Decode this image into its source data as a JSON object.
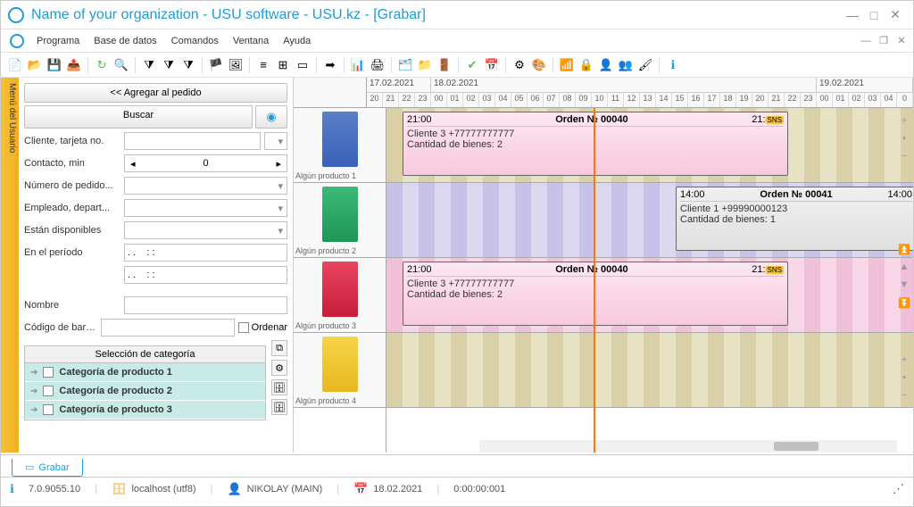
{
  "window": {
    "title": "Name of your organization - USU software - USU.kz - [Grabar]"
  },
  "menu": {
    "items": [
      "Programa",
      "Base de datos",
      "Comandos",
      "Ventana",
      "Ayuda"
    ]
  },
  "sidetab": "Menú del Usuario",
  "left": {
    "add_btn": "<< Agregar al pedido",
    "search_btn": "Buscar",
    "fields": {
      "cliente": "Cliente, tarjeta no.",
      "contacto": "Contacto, min",
      "contacto_val": "0",
      "pedido": "Número de pedido...",
      "empleado": "Empleado, depart...",
      "disponibles": "Están disponibles",
      "periodo": "En el período",
      "periodo_v1": ". .    : :",
      "periodo_v2": ". .    : :",
      "nombre": "Nombre",
      "barras": "Código de barras",
      "ordenar": "Ordenar"
    },
    "cat_hdr": "Selección de categoría",
    "cats": [
      "Categoría de producto 1",
      "Categoría de producto 2",
      "Categoría de producto 3"
    ]
  },
  "scheduler": {
    "dates": [
      "17.02.2021",
      "18.02.2021",
      "19.02.2021"
    ],
    "hours1": [
      "20",
      "21",
      "22",
      "23"
    ],
    "hours2": [
      "00",
      "01",
      "02",
      "03",
      "04",
      "05",
      "06",
      "07",
      "08",
      "09",
      "10",
      "11",
      "12",
      "13",
      "14",
      "15",
      "16",
      "17",
      "18",
      "19",
      "20",
      "21",
      "22",
      "23"
    ],
    "hours3": [
      "00",
      "01",
      "02",
      "03",
      "04",
      "0"
    ],
    "products": [
      "Algún producto 1",
      "Algún producto 2",
      "Algún producto 3",
      "Algún producto 4"
    ],
    "orders": {
      "o1": {
        "start": "21:00",
        "title": "Orden № 00040",
        "end": "21:",
        "badge": "SNS",
        "client": "Cliente 3 +77777777777",
        "qty": "Cantidad de bienes: 2"
      },
      "o2": {
        "start": "14:00",
        "title": "Orden № 00041",
        "end": "14:00",
        "client": "Cliente 1 +99990000123",
        "qty": "Cantidad de bienes: 1"
      },
      "o3": {
        "start": "21:00",
        "title": "Orden № 00040",
        "end": "21:",
        "badge": "SNS",
        "client": "Cliente 3 +77777777777",
        "qty": "Cantidad de bienes: 2"
      }
    }
  },
  "tab": "Grabar",
  "status": {
    "version": "7.0.9055.10",
    "host": "localhost (utf8)",
    "user": "NIKOLAY (MAIN)",
    "date": "18.02.2021",
    "time": "0:00:00:001"
  }
}
